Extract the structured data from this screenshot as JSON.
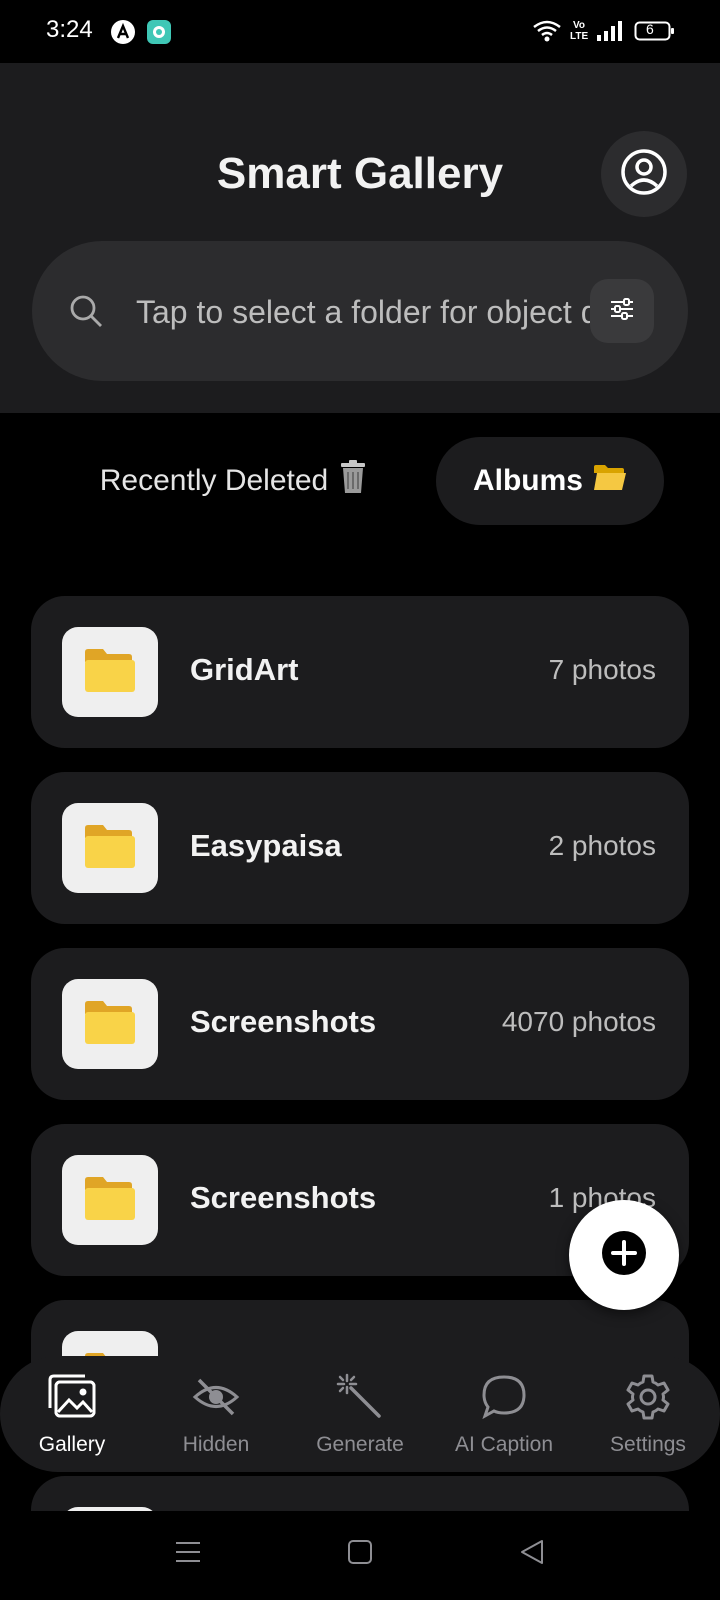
{
  "status_bar": {
    "time": "3:24",
    "network_label": "Vo LTE",
    "battery": "6",
    "icons": [
      "app-a-icon",
      "app-teal-icon",
      "wifi-icon",
      "volte-icon",
      "signal-icon",
      "battery-icon"
    ]
  },
  "header": {
    "title": "Smart Gallery",
    "profile_icon": "profile-icon"
  },
  "search": {
    "placeholder": "Tap to select a folder for object detection",
    "value": "",
    "search_icon": "search-icon",
    "filter_icon": "filter-icon"
  },
  "tabs": [
    {
      "label": "Recently Deleted",
      "emoji": "🗑️",
      "active": false
    },
    {
      "label": "Albums",
      "emoji": "📂",
      "active": true
    }
  ],
  "albums": [
    {
      "name": "GridArt",
      "count": "7 photos",
      "icon": "folder-icon"
    },
    {
      "name": "Easypaisa",
      "count": "2 photos",
      "icon": "folder-icon"
    },
    {
      "name": "Screenshots",
      "count": "4070 photos",
      "icon": "folder-icon"
    },
    {
      "name": "Screenshots",
      "count": "1 photos",
      "icon": "folder-icon"
    },
    {
      "name": "",
      "count": "",
      "icon": "folder-icon"
    },
    {
      "name": "",
      "count": "",
      "icon": "folder-icon"
    }
  ],
  "fab": {
    "icon": "plus-icon"
  },
  "bottom_nav": [
    {
      "label": "Gallery",
      "icon": "gallery-icon",
      "active": true
    },
    {
      "label": "Hidden",
      "icon": "eye-off-icon",
      "active": false
    },
    {
      "label": "Generate",
      "icon": "magic-wand-icon",
      "active": false
    },
    {
      "label": "AI Caption",
      "icon": "chat-bubble-icon",
      "active": false
    },
    {
      "label": "Settings",
      "icon": "gear-icon",
      "active": false
    }
  ],
  "colors": {
    "background": "#000000",
    "surface": "#1c1c1e",
    "surface_raised": "#2c2c2e",
    "text_primary": "#f2f2f2",
    "text_secondary": "#bdbdbd",
    "folder_yellow": "#f5c842"
  }
}
